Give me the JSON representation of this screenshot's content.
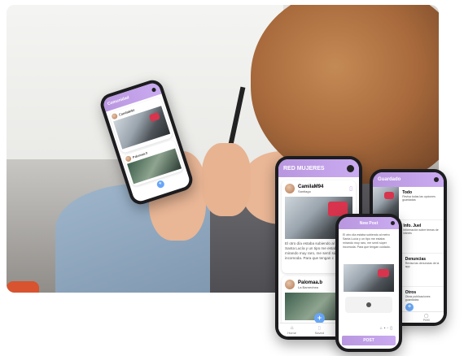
{
  "app": {
    "name": "RED MUJERES"
  },
  "front_phone": {
    "header": "RED MUJERES",
    "post1": {
      "user": "CamilaM94",
      "location": "Santiago",
      "body": "El otro día estaba subiendo al metro Santa Lucía y un tipo me estaba mirando muy raro, me sentí súper incomoda. Para que tengan c"
    },
    "post2": {
      "user": "Palomaa.b",
      "location": "La Barnechea"
    },
    "nav": [
      "Home",
      "Saved",
      "Perfil"
    ],
    "fab": "+"
  },
  "right_phone": {
    "header": "Guardado",
    "items": [
      {
        "title": "Todo",
        "desc": "Revisa todas las opciones guardadas"
      },
      {
        "title": "Info. Juel",
        "desc": "Información sobre temas de interés"
      },
      {
        "title": "Denuncias",
        "desc": "Revisa las denuncias de la app"
      },
      {
        "title": "Otros",
        "desc": "Otras publicaciones guardadas"
      }
    ],
    "nav": [
      "Saved",
      "Perfil"
    ]
  },
  "middle_phone": {
    "header": "New Post",
    "body": "El otro día estaba subiendo al metro Santa Lucía y un tipo me estaba mirando muy raro, me sentí súper incomoda. Para que tengan cuidado.",
    "post_button": "POST"
  },
  "hand_phone": {
    "header": "Comunidad",
    "post1": {
      "user": "CamilaM94"
    },
    "post2": {
      "user": "Palomaa.b"
    }
  }
}
